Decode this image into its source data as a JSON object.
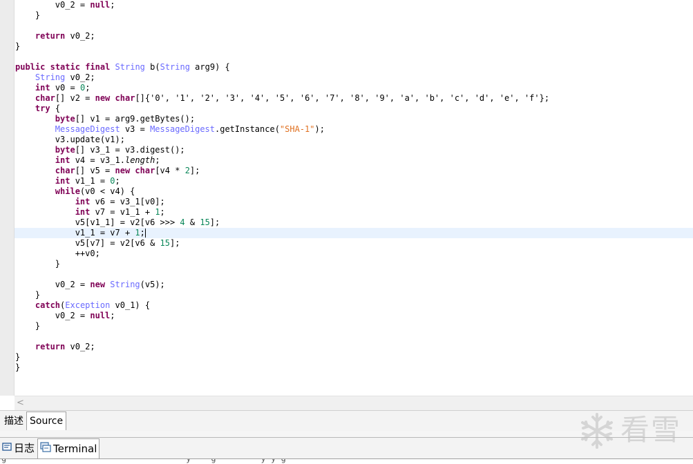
{
  "code_lines": [
    "        v0_2 = null;",
    "    }",
    "",
    "    return v0_2;",
    "}",
    "",
    "public static final String b(String arg9) {",
    "    String v0_2;",
    "    int v0 = 0;",
    "    char[] v2 = new char[]{'0', '1', '2', '3', '4', '5', '6', '7', '8', '9', 'a', 'b', 'c', 'd', 'e', 'f'};",
    "    try {",
    "        byte[] v1 = arg9.getBytes();",
    "        MessageDigest v3 = MessageDigest.getInstance(\"SHA-1\");",
    "        v3.update(v1);",
    "        byte[] v3_1 = v3.digest();",
    "        int v4 = v3_1.length;",
    "        char[] v5 = new char[v4 * 2];",
    "        int v1_1 = 0;",
    "        while(v0 < v4) {",
    "            int v6 = v3_1[v0];",
    "            int v7 = v1_1 + 1;",
    "            v5[v1_1] = v2[v6 >>> 4 & 15];",
    "            v1_1 = v7 + 1;",
    "            v5[v7] = v2[v6 & 15];",
    "            ++v0;",
    "        }",
    "",
    "        v0_2 = new String(v5);",
    "    }",
    "    catch(Exception v0_1) {",
    "        v0_2 = null;",
    "    }",
    "",
    "    return v0_2;",
    "}",
    "}"
  ],
  "editor_tabs": [
    "描述",
    "Source"
  ],
  "active_editor_tab": "Source",
  "bottom_tabs": [
    {
      "label": "日志",
      "icon": "log-icon"
    },
    {
      "label": "Terminal",
      "icon": "terminal-icon"
    }
  ],
  "active_bottom_tab": "Terminal",
  "watermark": {
    "text": "看雪",
    "icon": "snowflake-icon"
  },
  "scroll_left_symbol": "<",
  "colors": {
    "keyword": "#7f0055",
    "type": "#6a6aff",
    "number": "#098658",
    "string": "#e07020",
    "current_line": "#e8f2fe",
    "gutter": "#ececec"
  }
}
